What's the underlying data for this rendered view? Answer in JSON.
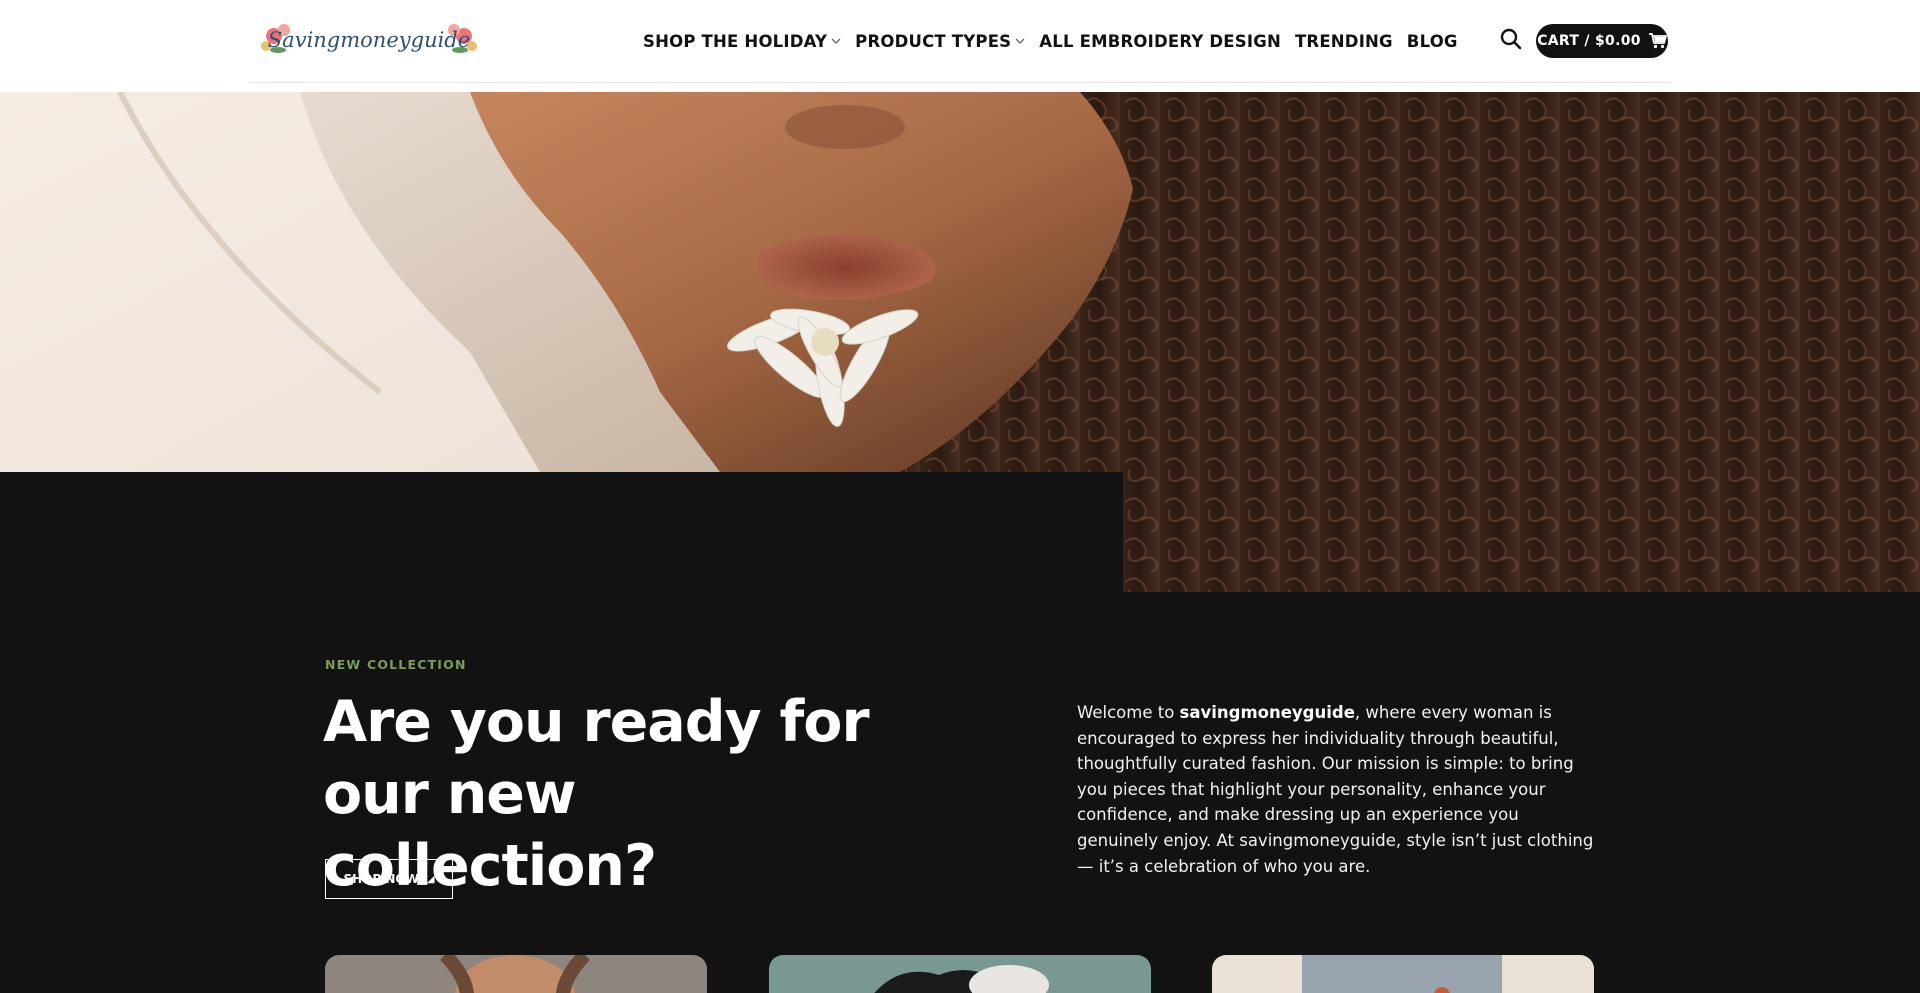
{
  "header": {
    "logo_text": "Savingmoneyguide",
    "nav": [
      {
        "label": "SHOP THE HOLIDAY",
        "has_dropdown": true
      },
      {
        "label": "PRODUCT TYPES",
        "has_dropdown": true
      },
      {
        "label": "ALL EMBROIDERY DESIGN",
        "has_dropdown": false
      },
      {
        "label": "TRENDING",
        "has_dropdown": false
      },
      {
        "label": "BLOG",
        "has_dropdown": false
      }
    ],
    "search_icon": "search-icon",
    "cart_label": "CART / $0.00",
    "cart_icon": "cart-icon"
  },
  "section": {
    "eyebrow": "NEW COLLECTION",
    "headline": "Are you ready for our new collection?",
    "cta_label": "SHOP NOW",
    "welcome_prefix": "Welcome to ",
    "welcome_brand": "savingmoneyguide",
    "welcome_rest": ", where every woman is encouraged to express her individuality through beautiful, thoughtfully curated fashion. Our mission is simple: to bring you pieces that highlight your personality, enhance your confidence, and make dressing up an experience you genuinely enjoy. At savingmoneyguide, style isn’t just clothing — it’s a celebration of who you are."
  },
  "colors": {
    "accent_green": "#7a9d57",
    "dark_bg": "#121212",
    "header_bg": "#ffffff",
    "cart_bg": "#111111"
  }
}
